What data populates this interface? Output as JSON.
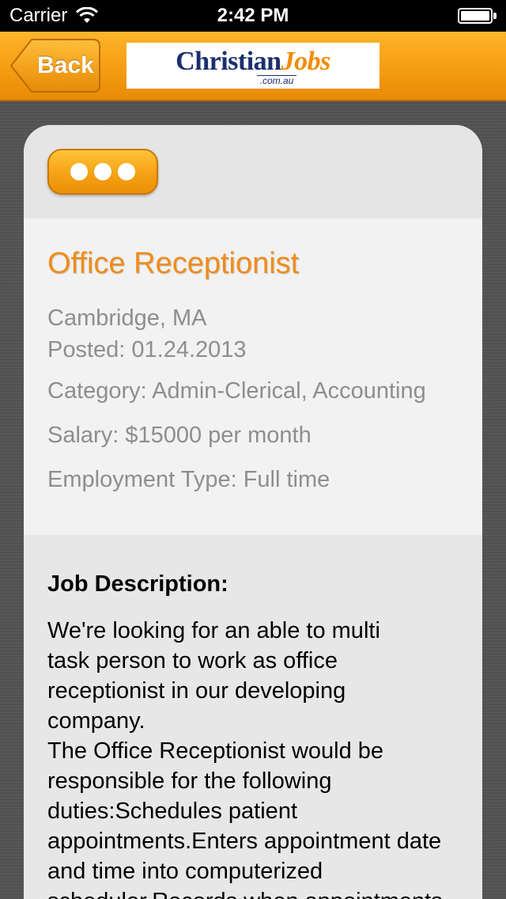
{
  "status_bar": {
    "carrier": "Carrier",
    "time": "2:42 PM"
  },
  "nav": {
    "back_label": "Back",
    "logo": {
      "word1": "Christian",
      "word2": "Jobs",
      "domain": ".com.au"
    },
    "accent_color": "#f59d12"
  },
  "job": {
    "title": "Office Receptionist",
    "location": "Cambridge, MA",
    "posted": "Posted: 01.24.2013",
    "category": "Category: Admin-Clerical, Accounting",
    "salary": "Salary: $15000 per month",
    "employment_type": "Employment Type: Full time"
  },
  "description": {
    "heading": "Job Description:",
    "body": "We're looking for an able to multi\ntask person to work as office\nreceptionist in our developing\ncompany.\nThe Office Receptionist would be\nresponsible for the following\nduties:Schedules patient\nappointments.Enters appointment date\nand time into computerized\nscheduler.Records when appointments"
  }
}
